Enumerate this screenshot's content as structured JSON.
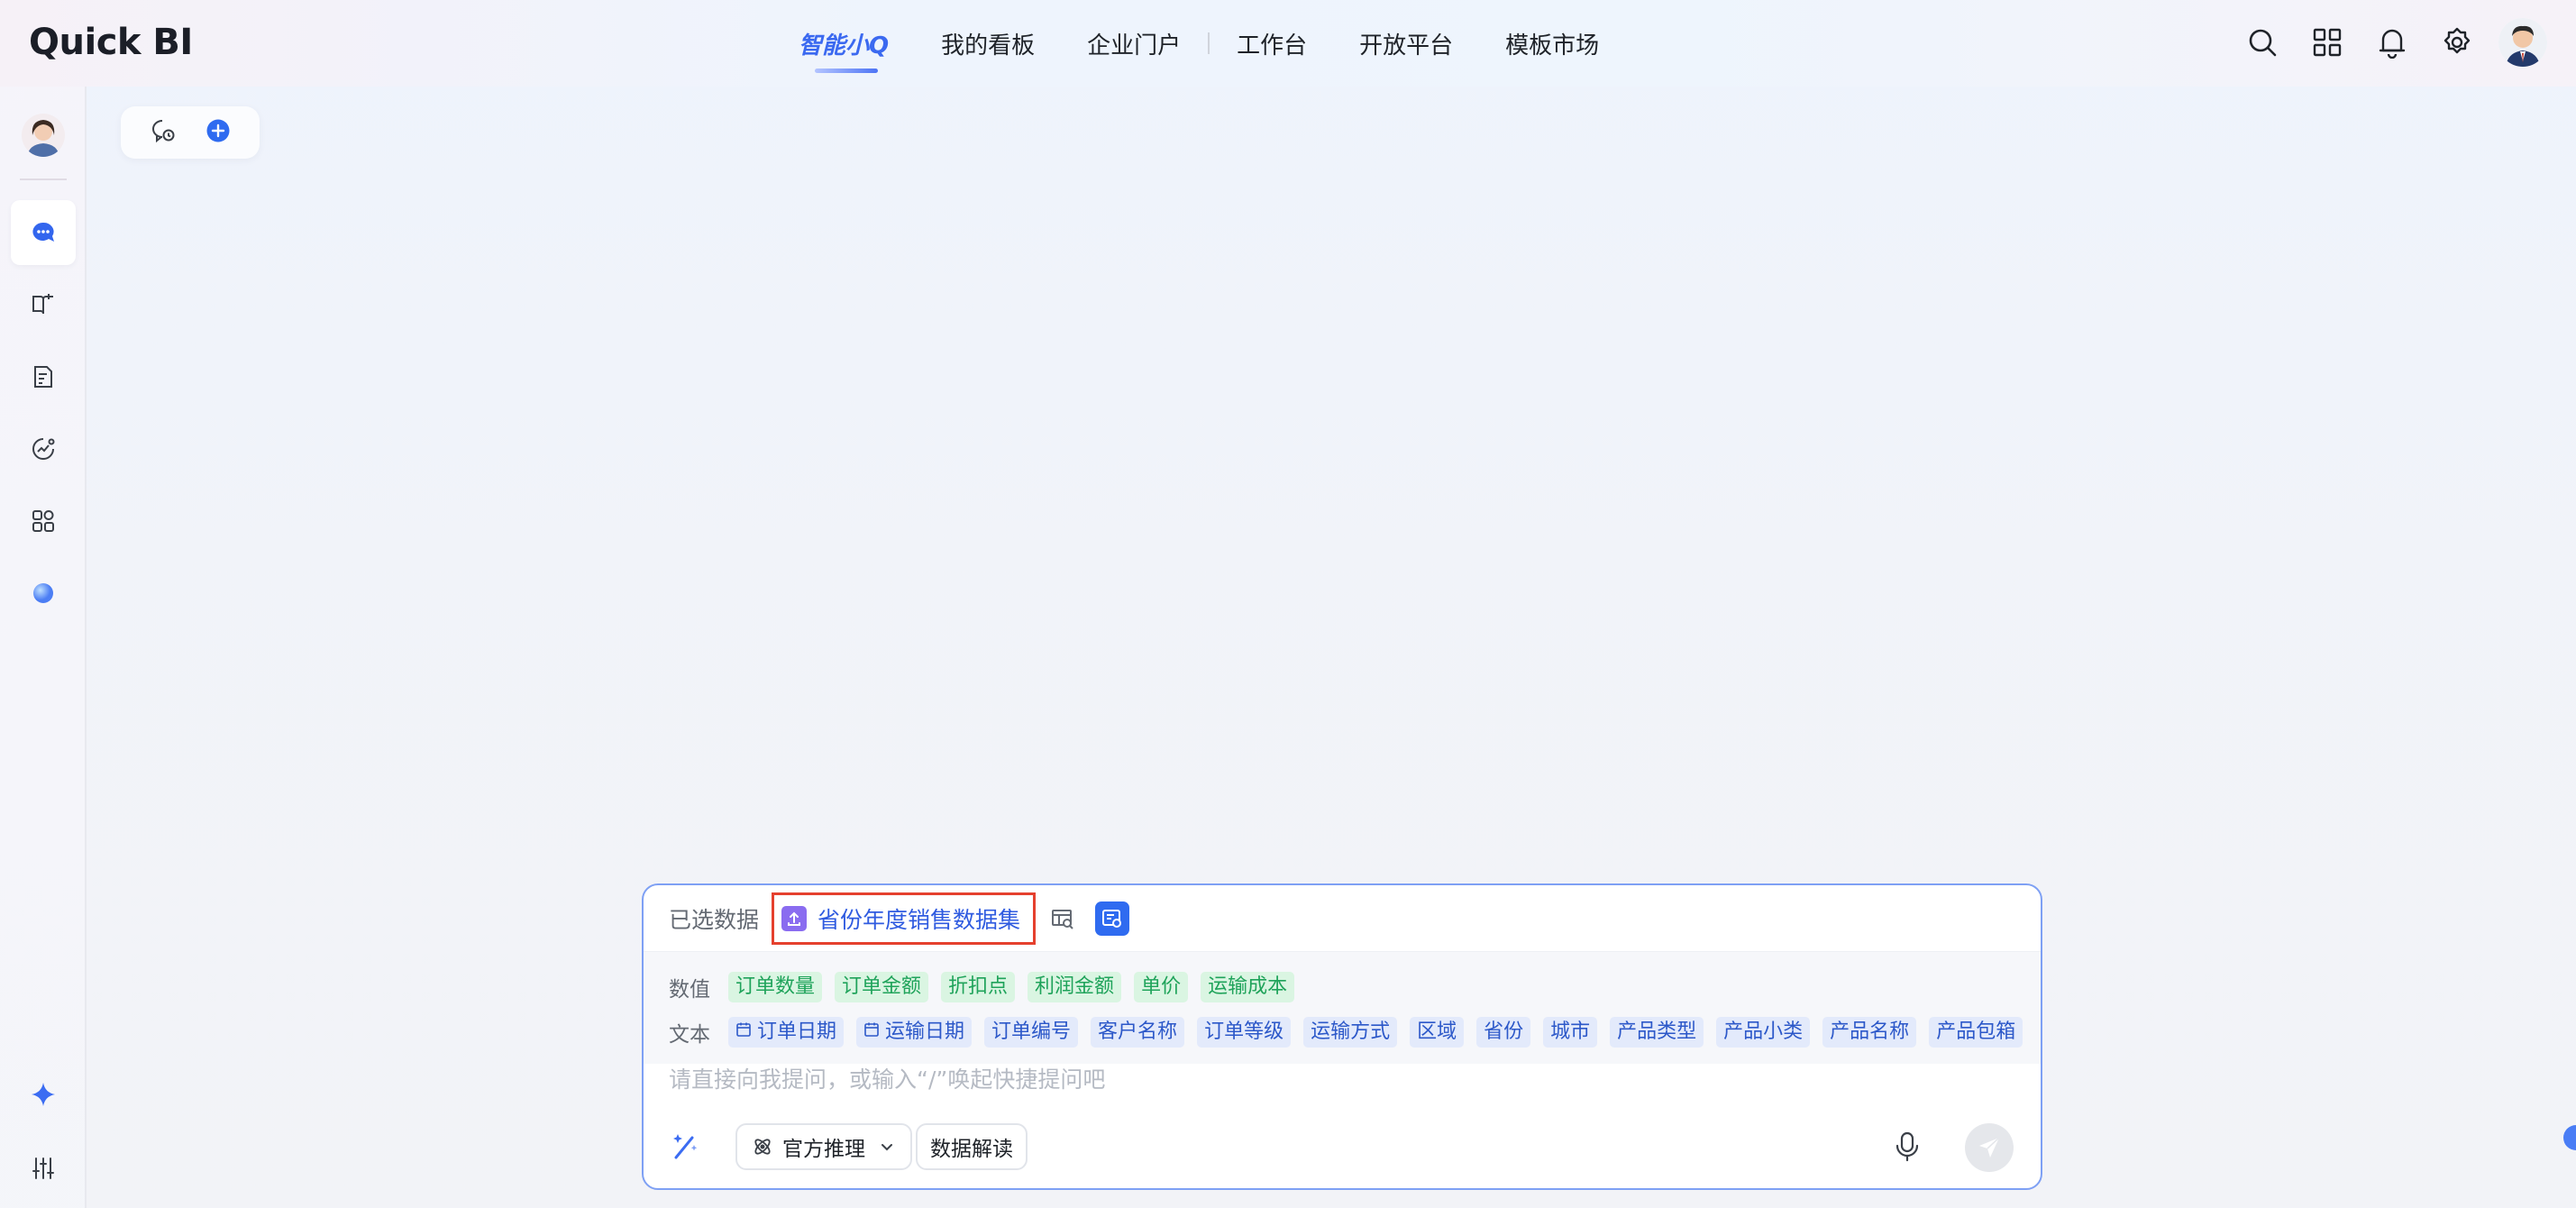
{
  "app": {
    "logo_text": "Quick BI"
  },
  "nav": {
    "items": [
      {
        "label": "智能小Q",
        "active": true
      },
      {
        "label": "我的看板",
        "active": false
      },
      {
        "label": "企业门户",
        "active": false
      },
      {
        "label": "工作台",
        "active": false
      },
      {
        "label": "开放平台",
        "active": false
      },
      {
        "label": "模板市场",
        "active": false
      }
    ]
  },
  "top_icons": [
    "search-icon",
    "grid-apps-icon",
    "bell-icon",
    "gear-icon",
    "user-avatar"
  ],
  "sidebar": {
    "items": [
      "chat-icon",
      "book-icon",
      "report-icon",
      "analysis-icon",
      "apps-icon",
      "orb-icon"
    ],
    "bottom_items": [
      "sparkle-icon",
      "sliders-icon"
    ]
  },
  "session_pill": {
    "icons": [
      "history-icon",
      "add-icon"
    ]
  },
  "composer": {
    "selected_label": "已选数据",
    "dataset_name": "省份年度销售数据集",
    "fields": {
      "numeric_label": "数值",
      "numeric": [
        "订单数量",
        "订单金额",
        "折扣点",
        "利润金额",
        "单价",
        "运输成本"
      ],
      "text_label": "文本",
      "text": [
        {
          "label": "订单日期",
          "date": true
        },
        {
          "label": "运输日期",
          "date": true
        },
        {
          "label": "订单编号",
          "date": false
        },
        {
          "label": "客户名称",
          "date": false
        },
        {
          "label": "订单等级",
          "date": false
        },
        {
          "label": "运输方式",
          "date": false
        },
        {
          "label": "区域",
          "date": false
        },
        {
          "label": "省份",
          "date": false
        },
        {
          "label": "城市",
          "date": false
        },
        {
          "label": "产品类型",
          "date": false
        },
        {
          "label": "产品小类",
          "date": false
        },
        {
          "label": "产品名称",
          "date": false
        },
        {
          "label": "产品包箱",
          "date": false
        }
      ]
    },
    "prompt_placeholder": "请直接向我提问，或输入“/”唤起快捷提问吧",
    "mode_select": "官方推理",
    "interpret_button": "数据解读"
  },
  "colors": {
    "accent": "#3b69f0",
    "highlight_border": "#e5402e",
    "numeric_tag": "#1fa35a",
    "text_tag": "#2c58c9"
  }
}
